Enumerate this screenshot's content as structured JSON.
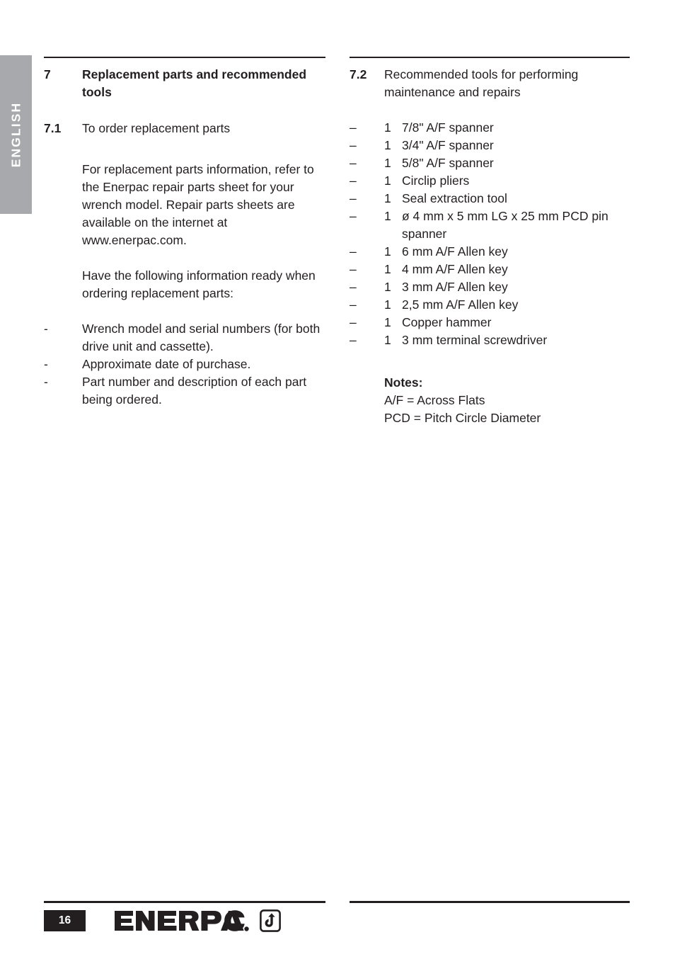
{
  "language_tab": {
    "label": "ENGLISH"
  },
  "sections": {
    "main": {
      "number": "7",
      "title": "Replacement parts and recommended tools"
    },
    "sub_7_1": {
      "number": "7.1",
      "title": "To order replacement parts",
      "paragraph_1": "For replacement parts information, refer to the Enerpac repair parts sheet for your wrench model. Repair parts sheets are available on the internet at www.enerpac.com.",
      "paragraph_2": "Have the following information ready when ordering replacement parts:",
      "bullet_marker": "-",
      "bullets": [
        "Wrench model and serial numbers (for both drive unit and cassette).",
        "Approximate date of purchase.",
        "Part number and description of each part being ordered."
      ]
    },
    "sub_7_2": {
      "number": "7.2",
      "title": "Recommended tools for performing maintenance and repairs",
      "bullet_marker": "–",
      "tools": [
        {
          "qty": "1",
          "name": "7/8\" A/F spanner"
        },
        {
          "qty": "1",
          "name": "3/4\" A/F spanner"
        },
        {
          "qty": "1",
          "name": "5/8\" A/F spanner"
        },
        {
          "qty": "1",
          "name": "Circlip pliers"
        },
        {
          "qty": "1",
          "name": "Seal extraction tool"
        },
        {
          "qty": "1",
          "name": "ø 4 mm x 5 mm LG x 25 mm PCD pin spanner"
        },
        {
          "qty": "1",
          "name": "6 mm A/F Allen key"
        },
        {
          "qty": "1",
          "name": "4 mm A/F Allen key"
        },
        {
          "qty": "1",
          "name": "3 mm A/F Allen key"
        },
        {
          "qty": "1",
          "name": "2,5 mm A/F Allen key"
        },
        {
          "qty": "1",
          "name": "Copper hammer"
        },
        {
          "qty": "1",
          "name": "3 mm terminal screwdriver"
        }
      ],
      "notes": {
        "title": "Notes:",
        "lines": [
          "A/F = Across Flats",
          "PCD = Pitch Circle Diameter"
        ]
      }
    }
  },
  "footer": {
    "page_number": "16",
    "brand": "ENERPAC",
    "brand_registered": "®"
  },
  "colors": {
    "text": "#231f20",
    "tab_gray": "#a7a9ac",
    "badge_bg": "#231f20"
  }
}
